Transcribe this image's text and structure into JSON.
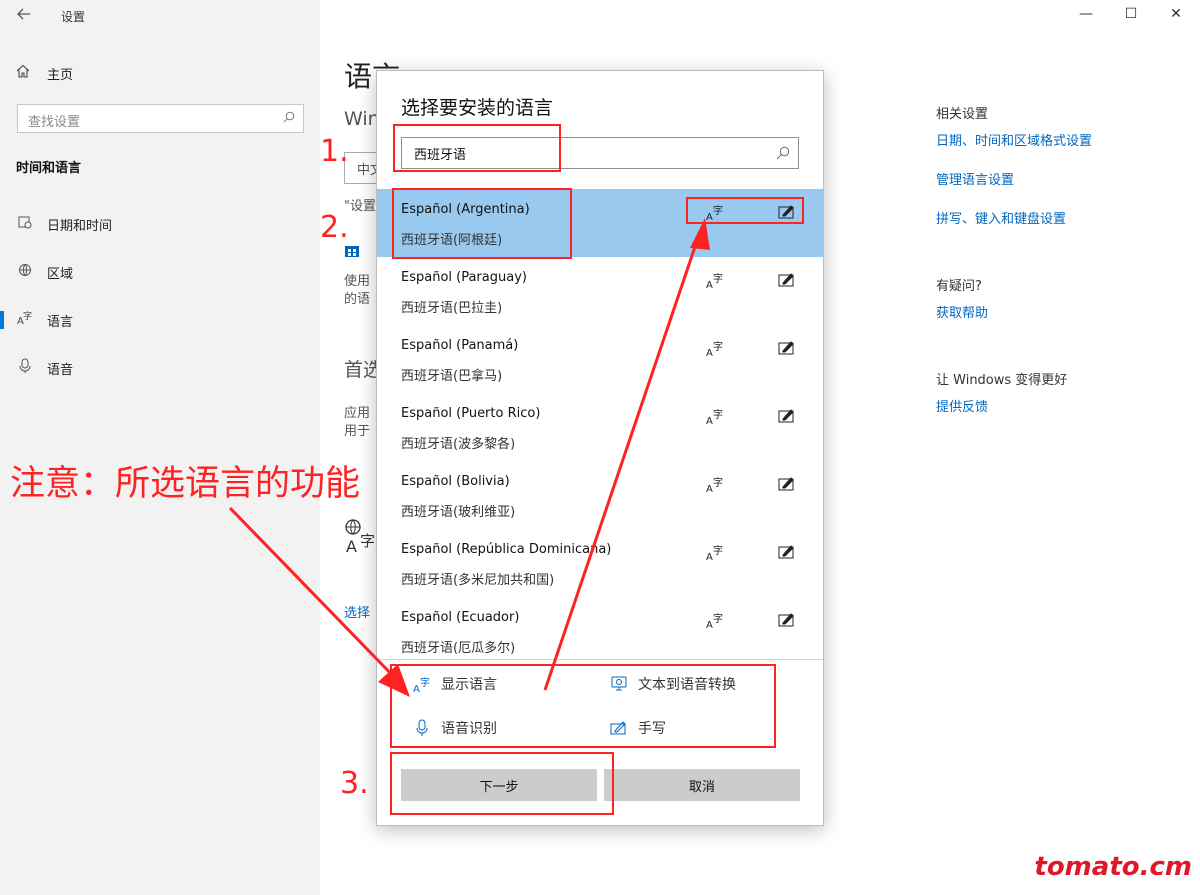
{
  "window": {
    "title": "设置",
    "controls": [
      "—",
      "☐",
      "✕"
    ]
  },
  "sidebar": {
    "home": "主页",
    "search_placeholder": "查找设置",
    "section": "时间和语言",
    "items": [
      {
        "label": "日期和时间",
        "icon": "calendar-clock-icon"
      },
      {
        "label": "区域",
        "icon": "globe-region-icon"
      },
      {
        "label": "语言",
        "icon": "language-icon"
      },
      {
        "label": "语音",
        "icon": "microphone-icon"
      }
    ]
  },
  "main": {
    "title": "语言",
    "windows_label": "Win",
    "lang_select": "中文",
    "note_prefix": "\"设置",
    "store_text_1": "使用",
    "store_text_2": "的语",
    "preferred_title": "首选",
    "pref_text_1": "应用",
    "pref_text_2": "用于",
    "link": "选择"
  },
  "right_panel": {
    "related_title": "相关设置",
    "links": [
      "日期、时间和区域格式设置",
      "管理语言设置",
      "拼写、键入和键盘设置"
    ],
    "question_title": "有疑问?",
    "help_link": "获取帮助",
    "improve_title": "让 Windows 变得更好",
    "feedback_link": "提供反馈"
  },
  "dialog": {
    "title": "选择要安装的语言",
    "search_value": "西班牙语",
    "languages": [
      {
        "name": "Español (Argentina)",
        "native": "西班牙语(阿根廷)",
        "selected": true
      },
      {
        "name": "Español (Paraguay)",
        "native": "西班牙语(巴拉圭)",
        "selected": false
      },
      {
        "name": "Español (Panamá)",
        "native": "西班牙语(巴拿马)",
        "selected": false
      },
      {
        "name": "Español (Puerto Rico)",
        "native": "西班牙语(波多黎各)",
        "selected": false
      },
      {
        "name": "Español (Bolivia)",
        "native": "西班牙语(玻利维亚)",
        "selected": false
      },
      {
        "name": "Español (República Dominicana)",
        "native": "西班牙语(多米尼加共和国)",
        "selected": false
      },
      {
        "name": "Español (Ecuador)",
        "native": "西班牙语(厄瓜多尔)",
        "selected": false
      }
    ],
    "legend": {
      "display": "显示语言",
      "tts": "文本到语音转换",
      "speech": "语音识别",
      "handwriting": "手写"
    },
    "next_button": "下一步",
    "cancel_button": "取消"
  },
  "annotations": {
    "step1": "1.",
    "step2": "2.",
    "step3": "3.",
    "note": "注意：所选语言的功能",
    "color": "#ff2222"
  },
  "watermark": "tomato.cm",
  "colors": {
    "accent": "#0067c0",
    "selected_row": "#99c9ee",
    "sidebar_bg": "#f2f2f2",
    "button_bg": "#cccccc"
  }
}
